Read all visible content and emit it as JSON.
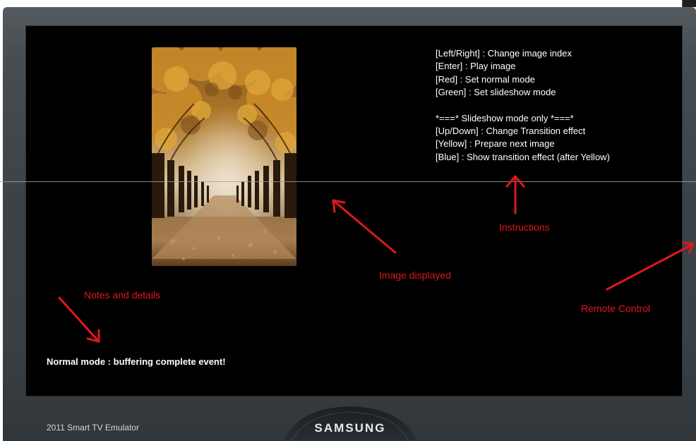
{
  "window": {
    "title": "2011 Smart TV Emulator"
  },
  "tv": {
    "brand": "SAMSUNG",
    "emulator_label": "2011 Smart TV Emulator"
  },
  "screen": {
    "image_description_icon": "autumn-tree-alley-photo",
    "instructions": [
      "[Left/Right] : Change image index",
      "[Enter] : Play image",
      "[Red] : Set normal mode",
      "[Green] : Set slideshow mode",
      "*===* Slideshow mode only *===*",
      "[Up/Down] : Change Transition effect",
      "[Yellow] : Prepare next image",
      "[Blue] : Show transition effect (after Yellow)"
    ],
    "status_text": "Normal mode : buffering complete event!"
  },
  "annotations": {
    "image_displayed": "Image displayed",
    "instructions": "Instructions",
    "notes_and_details": "Notes and details",
    "remote_control": "Remote Control",
    "color": "#e0171b"
  }
}
